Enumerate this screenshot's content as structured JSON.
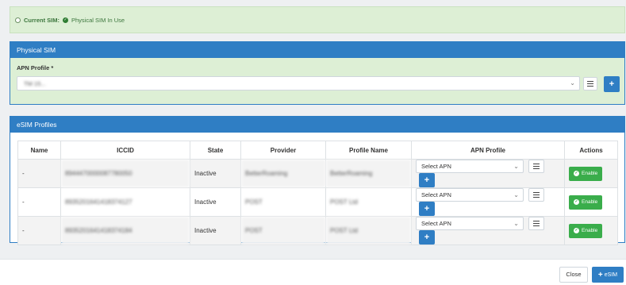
{
  "current_sim": {
    "label": "Current SIM:",
    "status": "Physical SIM In Use"
  },
  "physical_sim": {
    "title": "Physical SIM",
    "apn_label": "APN Profile *",
    "apn_value": "TM 15...",
    "list_icon": "list-icon",
    "add_icon": "plus-icon"
  },
  "esim_profiles": {
    "title": "eSIM Profiles",
    "columns": [
      "Name",
      "ICCID",
      "State",
      "Provider",
      "Profile Name",
      "APN Profile",
      "Actions"
    ],
    "rows": [
      {
        "name": "-",
        "iccid": "8944470000087780050",
        "state": "Inactive",
        "provider": "BetterRoaming",
        "profile_name": "BetterRoaming",
        "apn": "Select APN",
        "action": "Enable"
      },
      {
        "name": "-",
        "iccid": "8935201641418374127",
        "state": "Inactive",
        "provider": "POST",
        "profile_name": "POST Ltd",
        "apn": "Select APN",
        "action": "Enable"
      },
      {
        "name": "-",
        "iccid": "8935201641418374184",
        "state": "Inactive",
        "provider": "POST",
        "profile_name": "POST Ltd",
        "apn": "Select APN",
        "action": "Enable"
      }
    ]
  },
  "footer": {
    "close_label": "Close",
    "add_esim_label": "eSIM"
  },
  "colors": {
    "primary": "#2f7ec4",
    "success": "#3aad4b",
    "success_bg": "#ddefd5"
  }
}
